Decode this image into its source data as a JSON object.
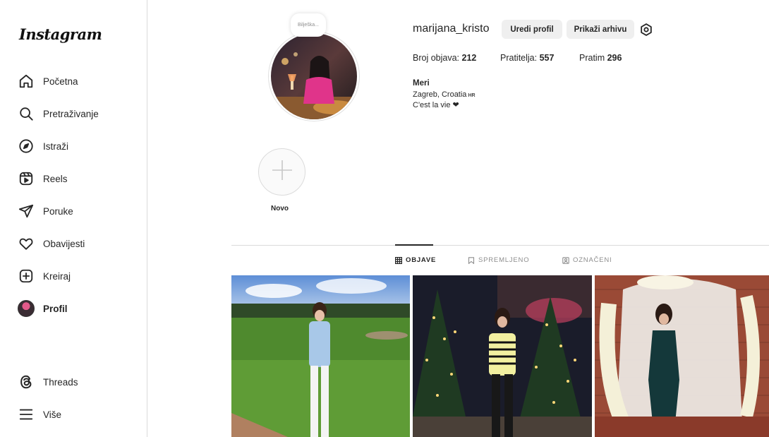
{
  "app": {
    "logo": "Instagram"
  },
  "sidebar": {
    "items": [
      {
        "label": "Početna",
        "icon": "home-icon"
      },
      {
        "label": "Pretraživanje",
        "icon": "search-icon"
      },
      {
        "label": "Istraži",
        "icon": "explore-compass-icon"
      },
      {
        "label": "Reels",
        "icon": "reels-icon"
      },
      {
        "label": "Poruke",
        "icon": "messages-send-icon"
      },
      {
        "label": "Obavijesti",
        "icon": "heart-icon"
      },
      {
        "label": "Kreiraj",
        "icon": "create-plus-icon"
      },
      {
        "label": "Profil",
        "icon": "profile-avatar"
      }
    ],
    "bottom": [
      {
        "label": "Threads",
        "icon": "threads-icon"
      },
      {
        "label": "Više",
        "icon": "menu-icon"
      }
    ]
  },
  "profile": {
    "note": "Bilješka...",
    "username": "marijana_kristo",
    "edit_label": "Uredi profil",
    "archive_label": "Prikaži arhivu",
    "stats": {
      "posts_label": "Broj objava:",
      "posts": "212",
      "followers_label": "Pratitelja:",
      "followers": "557",
      "following_label": "Pratim",
      "following": "296"
    },
    "bio": {
      "name": "Meri",
      "location": "Zagreb, Croatia",
      "country_code": "HR",
      "tagline": "C'est la vie ❤"
    }
  },
  "highlights": {
    "new_label": "Novo"
  },
  "tabs": [
    {
      "label": "OBJAVE",
      "active": true
    },
    {
      "label": "SPREMLJENO",
      "active": false
    },
    {
      "label": "OZNAČENI",
      "active": false
    }
  ],
  "colors": {
    "border": "#dbdbdb",
    "button_bg": "#efefef",
    "muted": "#8e8e8e",
    "text": "#262626"
  }
}
